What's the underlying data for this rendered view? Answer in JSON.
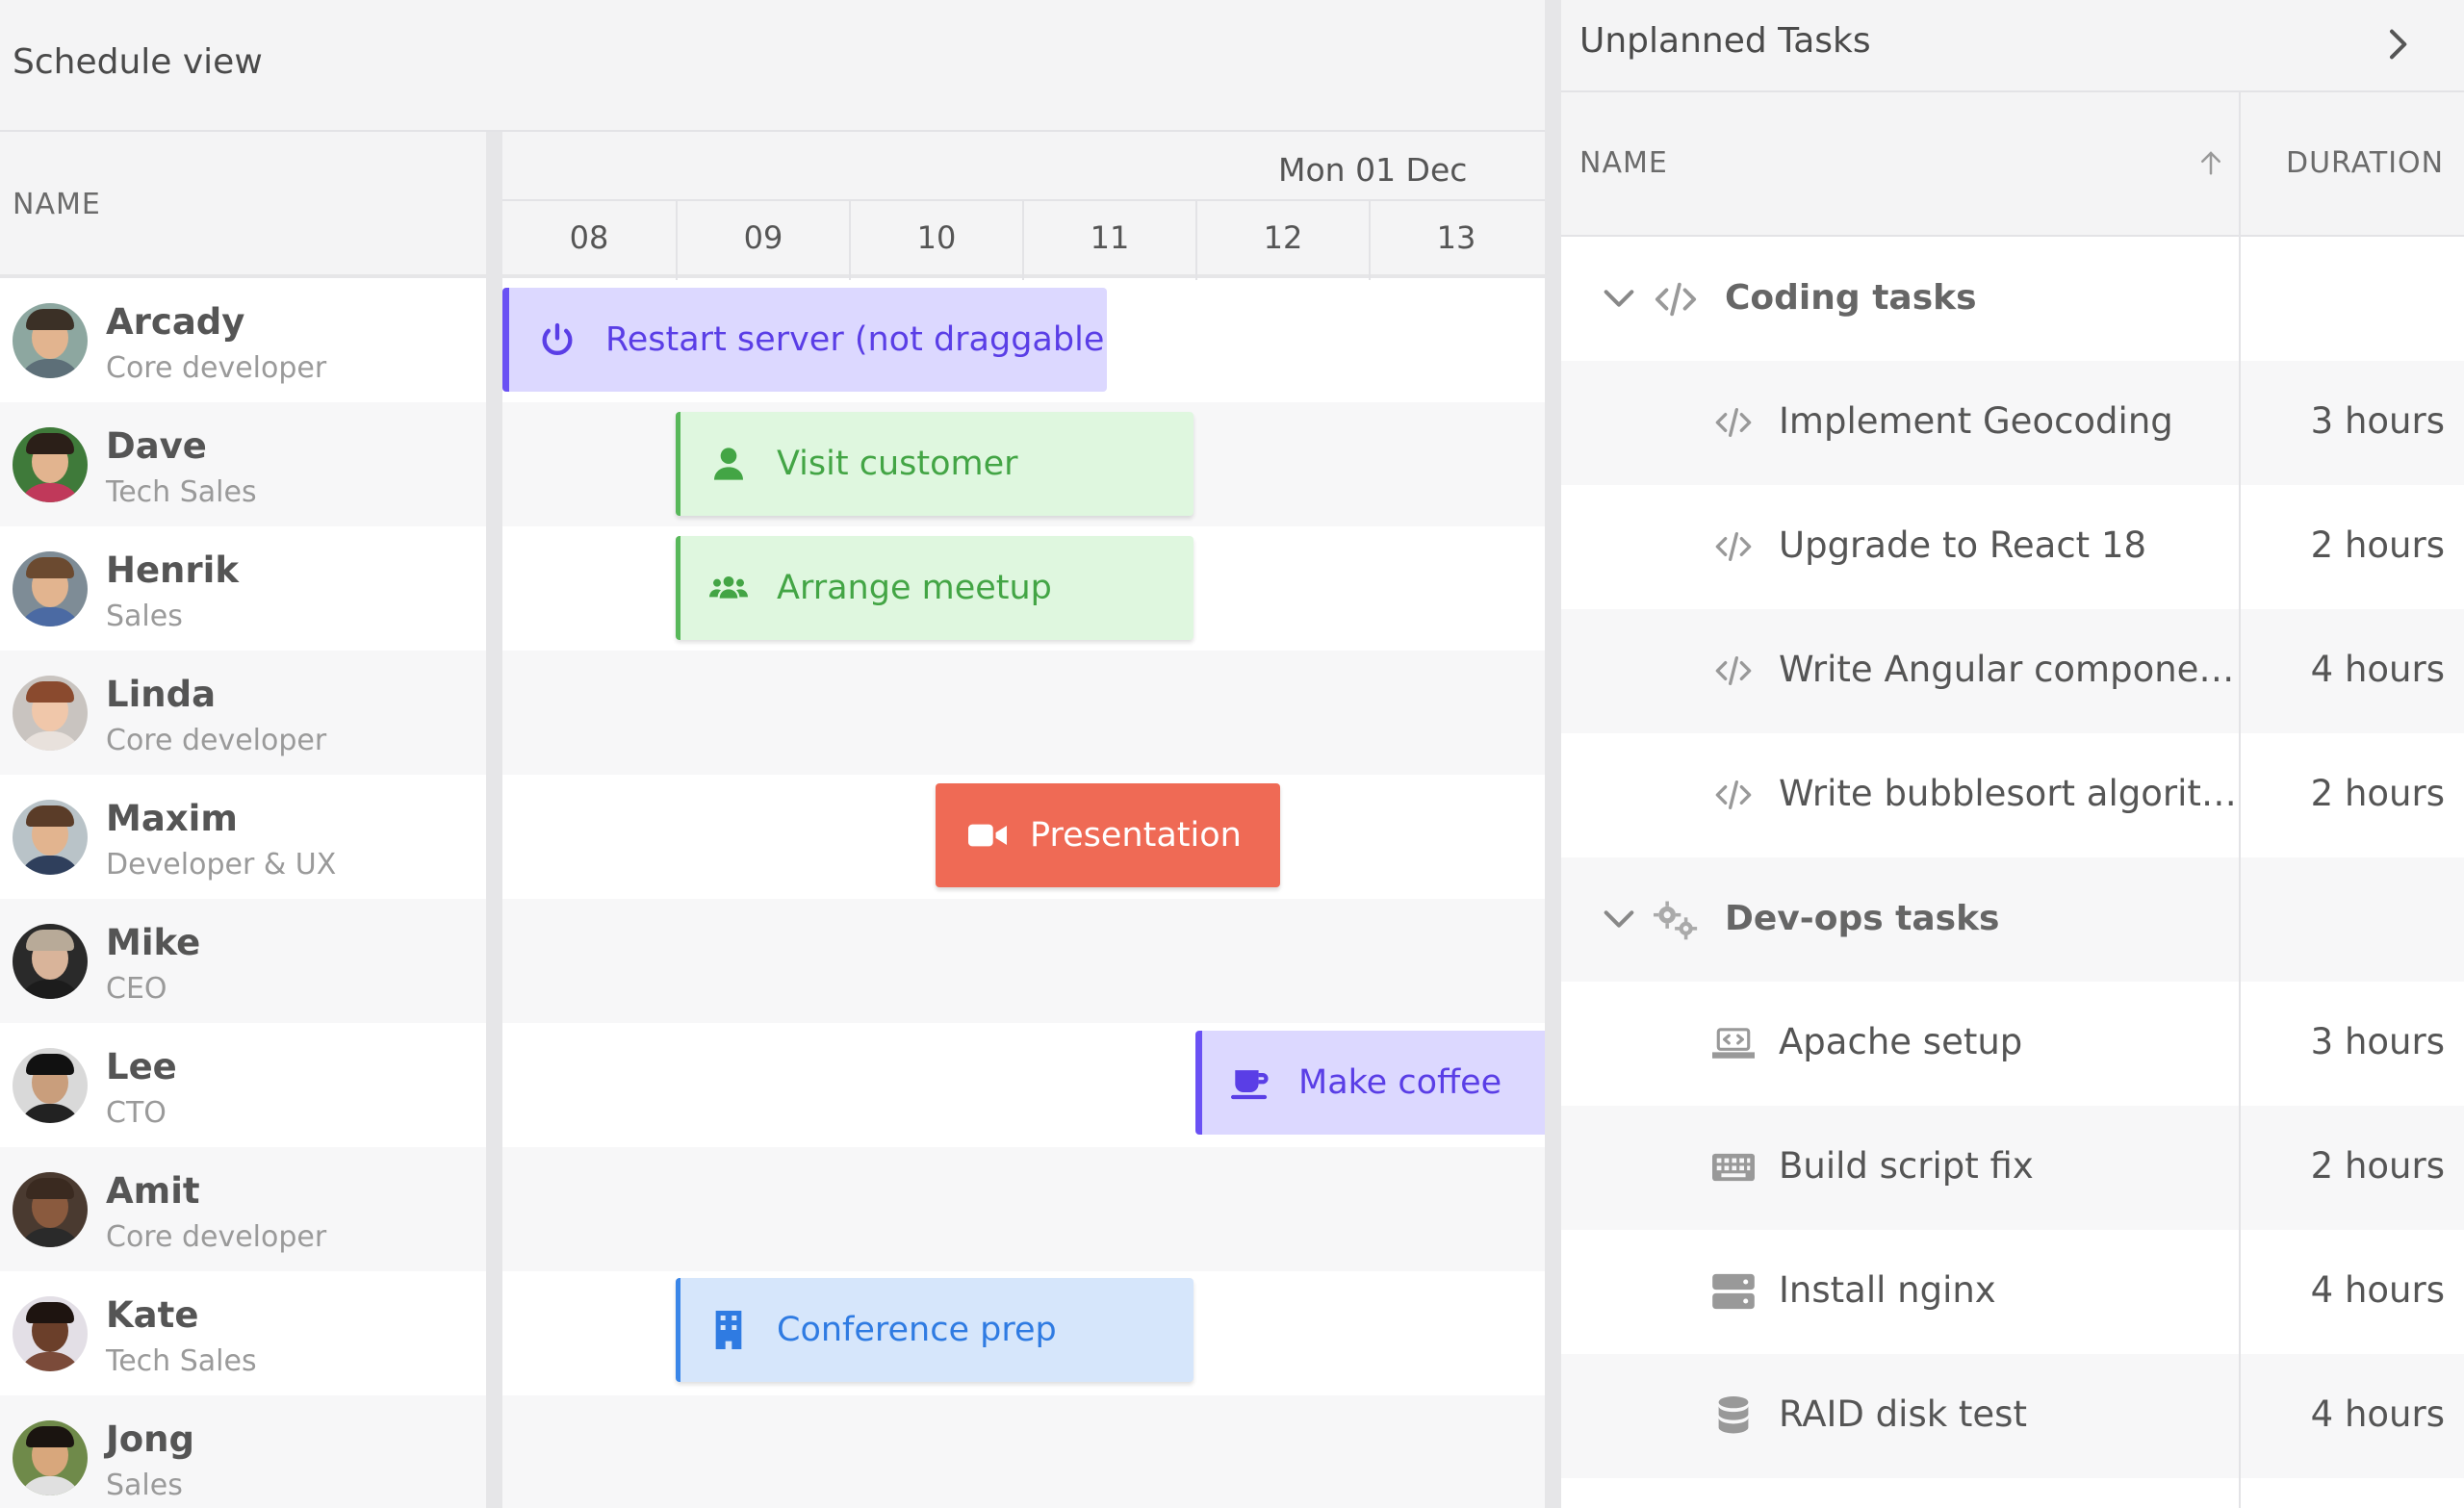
{
  "schedule": {
    "title": "Schedule view",
    "name_header": "NAME",
    "date": "Mon 01 Dec",
    "hours": [
      "08",
      "09",
      "10",
      "11",
      "12",
      "13"
    ],
    "resources": [
      {
        "name": "Arcady",
        "role": "Core developer"
      },
      {
        "name": "Dave",
        "role": "Tech Sales"
      },
      {
        "name": "Henrik",
        "role": "Sales"
      },
      {
        "name": "Linda",
        "role": "Core developer"
      },
      {
        "name": "Maxim",
        "role": "Developer & UX"
      },
      {
        "name": "Mike",
        "role": "CEO"
      },
      {
        "name": "Lee",
        "role": "CTO"
      },
      {
        "name": "Amit",
        "role": "Core developer"
      },
      {
        "name": "Kate",
        "role": "Tech Sales"
      },
      {
        "name": "Jong",
        "role": "Sales"
      }
    ],
    "events": [
      {
        "label": "Restart server (not draggable)",
        "icon": "power-icon",
        "resource": "Arcady",
        "color": "#6a51f4"
      },
      {
        "label": "Visit customer",
        "icon": "user-icon",
        "resource": "Dave",
        "color": "#58b85a"
      },
      {
        "label": "Arrange meetup",
        "icon": "users-icon",
        "resource": "Henrik",
        "color": "#58b85a"
      },
      {
        "label": "Presentation",
        "icon": "video-icon",
        "resource": "Maxim",
        "color": "#ef6a55"
      },
      {
        "label": "Make coffee",
        "icon": "coffee-icon",
        "resource": "Lee",
        "color": "#6a51f4"
      },
      {
        "label": "Conference prep",
        "icon": "building-icon",
        "resource": "Kate",
        "color": "#3a86e8"
      }
    ]
  },
  "unplanned": {
    "title": "Unplanned Tasks",
    "col_name": "NAME",
    "col_duration": "DURATION",
    "groups": [
      {
        "label": "Coding tasks",
        "icon": "code-icon",
        "tasks": [
          {
            "name": "Implement Geocoding",
            "duration": "3 hours",
            "icon": "code-icon"
          },
          {
            "name": "Upgrade to React 18",
            "duration": "2 hours",
            "icon": "code-icon"
          },
          {
            "name": "Write Angular compone…",
            "duration": "4 hours",
            "icon": "code-icon"
          },
          {
            "name": "Write bubblesort algorit…",
            "duration": "2 hours",
            "icon": "code-icon"
          }
        ]
      },
      {
        "label": "Dev-ops tasks",
        "icon": "cogs-icon",
        "tasks": [
          {
            "name": "Apache setup",
            "duration": "3 hours",
            "icon": "laptop-code-icon"
          },
          {
            "name": "Build script fix",
            "duration": "2 hours",
            "icon": "keyboard-icon"
          },
          {
            "name": "Install nginx",
            "duration": "4 hours",
            "icon": "server-icon"
          },
          {
            "name": "RAID disk test",
            "duration": "4 hours",
            "icon": "database-icon"
          }
        ]
      }
    ]
  }
}
